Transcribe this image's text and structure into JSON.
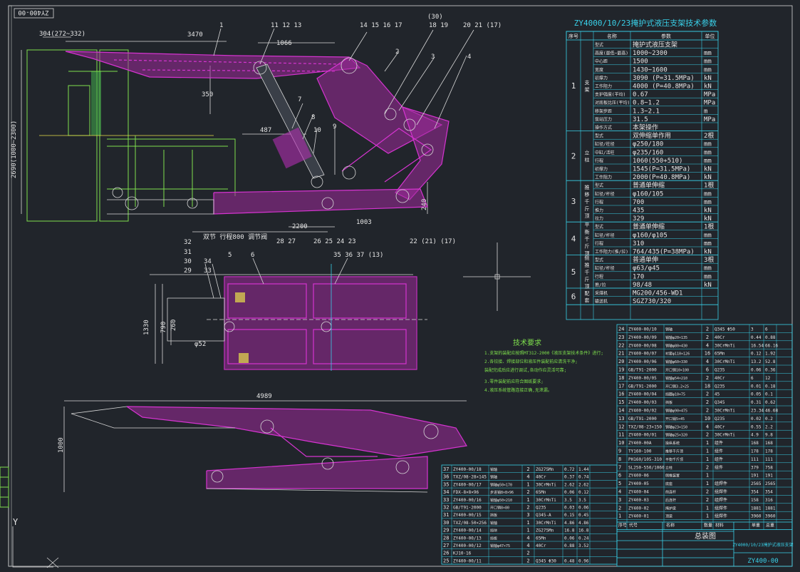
{
  "title_block": {
    "drawing_no_rotated": "ZY400-00",
    "sheet_title": "ZY4000/10/23掩护式液压支架技术参数",
    "assembly_title": "总装图",
    "product_name": "ZY4000/10/23掩护式液压支架",
    "drawing_code": "ZY400-00"
  },
  "dimensions": {
    "top_width": "3470",
    "offset": "304(272~332)",
    "span_1066": "1066",
    "dim_350": "350",
    "dim_487": "487",
    "height_range": "2690(1000~2300)",
    "dim_2200": "2200",
    "dim_1003": "1003",
    "dim_240": "240",
    "dim_1330": "1330",
    "dim_790": "790",
    "dim_260": "260",
    "dim_phi52": "φ52",
    "bottom_length": "4989",
    "bottom_height": "1000",
    "cylinder_note": "双节 行程800 调节阀"
  },
  "callouts_top": [
    "1",
    "11 12 13",
    "14 15 16 17",
    "(30)",
    "18 19",
    "20 21 (17)",
    "2",
    "3",
    "4",
    "7",
    "8",
    "9",
    "10",
    "22 (21) (17)",
    "28 27",
    "26 25 24 23"
  ],
  "callouts_mid": [
    "32",
    "31",
    "30",
    "29",
    "34",
    "33",
    "5",
    "6",
    "35 36 37 (13)"
  ],
  "tech_requirements": {
    "heading": "技术要求",
    "items": [
      "1.支架的装配应按照MT312-2000《液压支架技术条件》进行;",
      "2.各铰接、焊接部位和液压件装配前应清洗干净;",
      "  装配完成后应进行调试,各动作应灵活可靠;",
      "3.零件装配前应符合图纸要求;",
      "4.液压系统管路连接正确,无泄漏。"
    ]
  },
  "params_table": {
    "header": [
      "序号",
      "名称",
      "参数",
      "单位"
    ],
    "groups": [
      {
        "no": "1",
        "name": "支架",
        "rows": [
          [
            "型式",
            "掩护式液压支架",
            ""
          ],
          [
            "高度(最低~最高)",
            "1000~2300",
            "mm"
          ],
          [
            "中心距",
            "1500",
            "mm"
          ],
          [
            "宽度",
            "1430~1600",
            "mm"
          ],
          [
            "初撑力",
            "3090 (P=31.5MPa)",
            "kN"
          ],
          [
            "工作阻力",
            "4000 (P=40.8MPa)",
            "kN"
          ],
          [
            "支护强度(平均)",
            "0.67",
            "MPa"
          ],
          [
            "对底板比压(平均)",
            "0.8~1.2",
            "MPa"
          ],
          [
            "移架步距",
            "1.3~2.1",
            "m"
          ],
          [
            "泵站压力",
            "31.5",
            "MPa"
          ],
          [
            "操作方式",
            "本架操作",
            ""
          ]
        ]
      },
      {
        "no": "2",
        "name": "立柱",
        "rows": [
          [
            "型式",
            "双伸缩单作用",
            "2根"
          ],
          [
            "缸径/柱径",
            "φ250/180",
            "mm"
          ],
          [
            "中缸/活柱",
            "φ235/160",
            "mm"
          ],
          [
            "行程",
            "1060(550+510)",
            "mm"
          ],
          [
            "初撑力",
            "1545(P=31.5MPa)",
            "kN"
          ],
          [
            "工作阻力",
            "2000(P=40.8MPa)",
            "kN"
          ]
        ]
      },
      {
        "no": "3",
        "name": "推移千斤顶",
        "rows": [
          [
            "型式",
            "普通单伸缩",
            "1根"
          ],
          [
            "缸径/杆径",
            "φ160/105",
            "mm"
          ],
          [
            "行程",
            "700",
            "mm"
          ],
          [
            "推力",
            "435",
            "kN"
          ],
          [
            "拉力",
            "329",
            "kN"
          ]
        ]
      },
      {
        "no": "4",
        "name": "平衡千斤顶",
        "rows": [
          [
            "型式",
            "普通单伸缩",
            "1根"
          ],
          [
            "缸径/杆径",
            "φ160/φ105",
            "mm"
          ],
          [
            "行程",
            "310",
            "mm"
          ],
          [
            "工作阻力(推/拉)",
            "764/435(P=38MPa)",
            "kN"
          ]
        ]
      },
      {
        "no": "5",
        "name": "侧推千斤顶",
        "rows": [
          [
            "型式",
            "普通单伸",
            "3根"
          ],
          [
            "缸径/杆径",
            "φ63/φ45",
            "mm"
          ],
          [
            "行程",
            "170",
            "mm"
          ],
          [
            "推/拉",
            "98/48",
            "kN"
          ]
        ]
      },
      {
        "no": "6",
        "name": "配套",
        "rows": [
          [
            "采煤机",
            "MG200/456-WD1",
            ""
          ],
          [
            "输送机",
            "SGZ730/320",
            ""
          ]
        ]
      }
    ]
  },
  "bom_right": {
    "rows": [
      [
        "24",
        "ZY400-00/10",
        "销轴",
        "2",
        "Q345 Φ50",
        "3",
        "6"
      ],
      [
        "23",
        "ZY400-00/09",
        "销轴φ20×135",
        "2",
        "40Cr",
        "0.44",
        "0.88"
      ],
      [
        "22",
        "ZY400-00/08",
        "销轴φ80×430",
        "4",
        "30CrMnTi",
        "16.54",
        "66.16"
      ],
      [
        "21",
        "ZY400-00/07",
        "衬套φ110×126",
        "16",
        "65Mn",
        "0.12",
        "1.92"
      ],
      [
        "20",
        "ZY400-00/06",
        "销轴φ60×330",
        "4",
        "30CrMnTi",
        "13.2",
        "52.8"
      ],
      [
        "19",
        "GB/T91-2000",
        "开口销10×100",
        "6",
        "Q235",
        "0.06",
        "0.36"
      ],
      [
        "18",
        "ZY400-00/05",
        "销轴φ54×210",
        "2",
        "40Cr",
        "6",
        "12"
      ],
      [
        "17",
        "GB/T91-2000",
        "开口销3.2×25",
        "18",
        "Q235",
        "0.01",
        "0.18"
      ],
      [
        "16",
        "ZY400-00/04",
        "挡圈φ10×75",
        "2",
        "45",
        "0.05",
        "0.1"
      ],
      [
        "15",
        "ZY400-00/03",
        "挡板",
        "2",
        "Q345",
        "0.31",
        "0.62"
      ],
      [
        "14",
        "ZY400-00/02",
        "销轴φ90×475",
        "2",
        "30CrMnTi",
        "23.34",
        "46.68"
      ],
      [
        "13",
        "GB/T91-2000",
        "开口销5×45",
        "10",
        "Q235",
        "0.02",
        "0.2"
      ],
      [
        "12",
        "TXZ/08-23×150",
        "销轴φ23×150",
        "4",
        "40Cr",
        "0.55",
        "2.2"
      ],
      [
        "11",
        "ZY400-00/01",
        "销轴φ25×320",
        "2",
        "30CrMnTi",
        "4.9",
        "9.8"
      ],
      [
        "10",
        "ZY400-00A",
        "操纵系统",
        "1",
        "组件",
        "168",
        "168"
      ],
      [
        "9",
        "TY160-100",
        "推移千斤顶",
        "1",
        "组件",
        "178",
        "178"
      ],
      [
        "8",
        "PH160/105-310",
        "平衡千斤顶",
        "1",
        "组件",
        "111",
        "111"
      ],
      [
        "7",
        "SL250-550/1060",
        "立柱",
        "2",
        "组件",
        "379",
        "758"
      ],
      [
        "6",
        "ZY400-06",
        "侧推装置",
        "1",
        "",
        "191",
        "191"
      ],
      [
        "5",
        "ZY400-05",
        "底座",
        "1",
        "组焊件",
        "2565",
        "2565"
      ],
      [
        "4",
        "ZY400-04",
        "前连杆",
        "2",
        "组焊件",
        "354",
        "354"
      ],
      [
        "3",
        "ZY400-03",
        "后连杆",
        "2",
        "组焊件",
        "158",
        "316"
      ],
      [
        "2",
        "ZY400-02",
        "掩护梁",
        "1",
        "组焊件",
        "1881",
        "1881"
      ],
      [
        "1",
        "ZY400-01",
        "顶梁",
        "1",
        "组焊件",
        "3960",
        "3960"
      ]
    ],
    "header": [
      "序号",
      "代号",
      "名称",
      "数量",
      "材料",
      "单重",
      "总重"
    ]
  },
  "bom_left": {
    "rows": [
      [
        "37",
        "ZY400-00/18",
        "销轴",
        "2",
        "ZG275Mn",
        "0.72",
        "1.44"
      ],
      [
        "36",
        "TXZ/08-28×145",
        "销轴",
        "4",
        "40Cr",
        "0.37",
        "0.74"
      ],
      [
        "35",
        "ZY400-00/17",
        "销轴φ50×170",
        "1",
        "30CrMnTi",
        "2.62",
        "2.62"
      ],
      [
        "34",
        "FDX-8×8×96",
        "步进销8×8×96",
        "2",
        "65Mn",
        "0.06",
        "0.12"
      ],
      [
        "33",
        "ZY400-00/16",
        "销轴φ50×210",
        "1",
        "30CrMnTi",
        "3.5",
        "3.5"
      ],
      [
        "32",
        "GB/T91-2000",
        "开口销8×80",
        "2",
        "Q235",
        "0.03",
        "0.06"
      ],
      [
        "31",
        "ZY400-00/15",
        "挡板",
        "3",
        "Q345-A",
        "0.15",
        "0.45"
      ],
      [
        "30",
        "TXZ/08-50×256",
        "销轴",
        "1",
        "30CrMnTi",
        "4.86",
        "4.86"
      ],
      [
        "29",
        "ZY400-00/14",
        "挡块",
        "1",
        "ZG275Mn",
        "16.8",
        "16.8"
      ],
      [
        "28",
        "ZY400-00/13",
        "挡板",
        "4",
        "65Mn",
        "0.06",
        "0.24"
      ],
      [
        "27",
        "ZY400-00/12",
        "销轴φ47×75",
        "4",
        "40Cr",
        "0.88",
        "3.52"
      ],
      [
        "26",
        "KJ10-16",
        "",
        "2",
        "",
        "",
        ""
      ],
      [
        "25",
        "ZY400-00/11",
        "",
        "2",
        "Q345 Φ30",
        "0.48",
        "0.96"
      ]
    ]
  },
  "crosshair_label": "Y"
}
